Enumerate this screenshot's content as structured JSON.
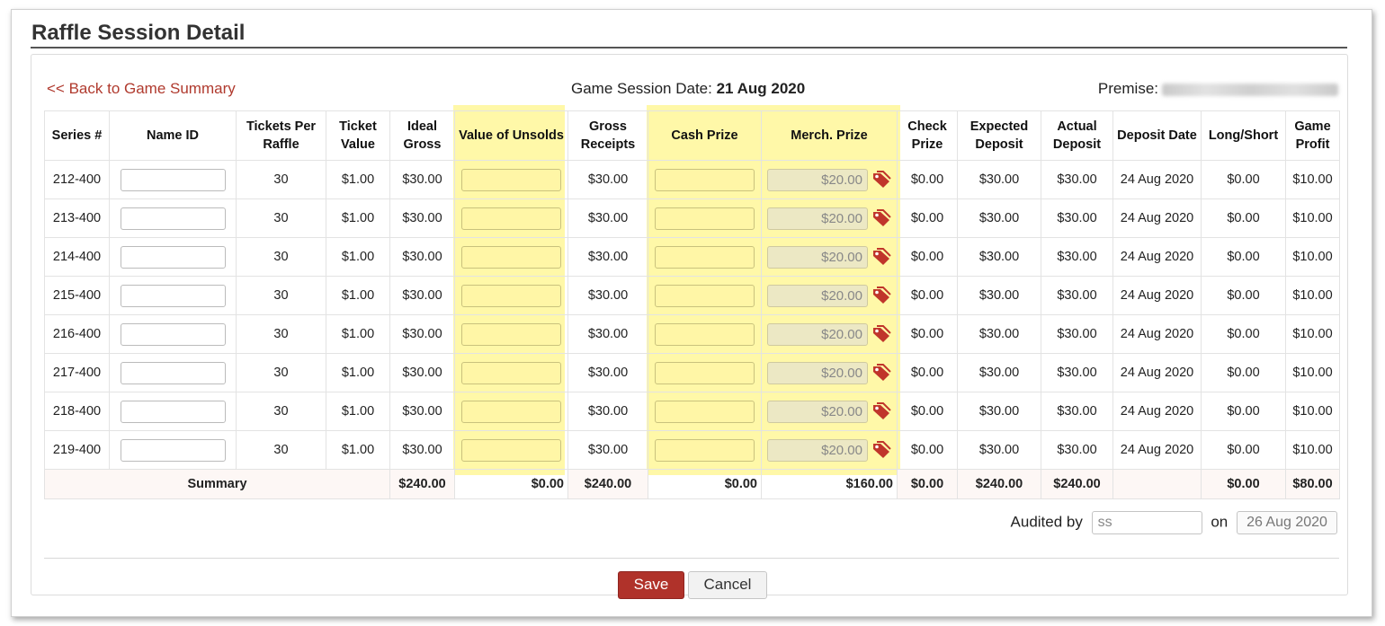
{
  "page_title": "Raffle Session Detail",
  "back_link": "<< Back to Game Summary",
  "session_date_label": "Game Session Date:",
  "session_date_value": "21 Aug 2020",
  "premise_label": "Premise:",
  "headers": [
    "Series #",
    "Name ID",
    "Tickets Per Raffle",
    "Ticket Value",
    "Ideal Gross",
    "Value of Unsolds",
    "Gross Receipts",
    "Cash Prize",
    "Merch. Prize",
    "Check Prize",
    "Expected Deposit",
    "Actual Deposit",
    "Deposit Date",
    "Long/Short",
    "Game Profit"
  ],
  "rows": [
    {
      "series": "212-400",
      "tickets": "30",
      "ticket_value": "$1.00",
      "ideal_gross": "$30.00",
      "gross_receipts": "$30.00",
      "merch_prize": "$20.00",
      "check_prize": "$0.00",
      "expected_deposit": "$30.00",
      "actual_deposit": "$30.00",
      "deposit_date": "24 Aug 2020",
      "long_short": "$0.00",
      "game_profit": "$10.00"
    },
    {
      "series": "213-400",
      "tickets": "30",
      "ticket_value": "$1.00",
      "ideal_gross": "$30.00",
      "gross_receipts": "$30.00",
      "merch_prize": "$20.00",
      "check_prize": "$0.00",
      "expected_deposit": "$30.00",
      "actual_deposit": "$30.00",
      "deposit_date": "24 Aug 2020",
      "long_short": "$0.00",
      "game_profit": "$10.00"
    },
    {
      "series": "214-400",
      "tickets": "30",
      "ticket_value": "$1.00",
      "ideal_gross": "$30.00",
      "gross_receipts": "$30.00",
      "merch_prize": "$20.00",
      "check_prize": "$0.00",
      "expected_deposit": "$30.00",
      "actual_deposit": "$30.00",
      "deposit_date": "24 Aug 2020",
      "long_short": "$0.00",
      "game_profit": "$10.00"
    },
    {
      "series": "215-400",
      "tickets": "30",
      "ticket_value": "$1.00",
      "ideal_gross": "$30.00",
      "gross_receipts": "$30.00",
      "merch_prize": "$20.00",
      "check_prize": "$0.00",
      "expected_deposit": "$30.00",
      "actual_deposit": "$30.00",
      "deposit_date": "24 Aug 2020",
      "long_short": "$0.00",
      "game_profit": "$10.00"
    },
    {
      "series": "216-400",
      "tickets": "30",
      "ticket_value": "$1.00",
      "ideal_gross": "$30.00",
      "gross_receipts": "$30.00",
      "merch_prize": "$20.00",
      "check_prize": "$0.00",
      "expected_deposit": "$30.00",
      "actual_deposit": "$30.00",
      "deposit_date": "24 Aug 2020",
      "long_short": "$0.00",
      "game_profit": "$10.00"
    },
    {
      "series": "217-400",
      "tickets": "30",
      "ticket_value": "$1.00",
      "ideal_gross": "$30.00",
      "gross_receipts": "$30.00",
      "merch_prize": "$20.00",
      "check_prize": "$0.00",
      "expected_deposit": "$30.00",
      "actual_deposit": "$30.00",
      "deposit_date": "24 Aug 2020",
      "long_short": "$0.00",
      "game_profit": "$10.00"
    },
    {
      "series": "218-400",
      "tickets": "30",
      "ticket_value": "$1.00",
      "ideal_gross": "$30.00",
      "gross_receipts": "$30.00",
      "merch_prize": "$20.00",
      "check_prize": "$0.00",
      "expected_deposit": "$30.00",
      "actual_deposit": "$30.00",
      "deposit_date": "24 Aug 2020",
      "long_short": "$0.00",
      "game_profit": "$10.00"
    },
    {
      "series": "219-400",
      "tickets": "30",
      "ticket_value": "$1.00",
      "ideal_gross": "$30.00",
      "gross_receipts": "$30.00",
      "merch_prize": "$20.00",
      "check_prize": "$0.00",
      "expected_deposit": "$30.00",
      "actual_deposit": "$30.00",
      "deposit_date": "24 Aug 2020",
      "long_short": "$0.00",
      "game_profit": "$10.00"
    }
  ],
  "summary": {
    "label": "Summary",
    "ideal_gross": "$240.00",
    "value_unsolds": "$0.00",
    "gross_receipts": "$240.00",
    "cash_prize": "$0.00",
    "merch_prize": "$160.00",
    "check_prize": "$0.00",
    "expected_deposit": "$240.00",
    "actual_deposit": "$240.00",
    "long_short": "$0.00",
    "game_profit": "$80.00"
  },
  "audit": {
    "label": "Audited by",
    "value": "ss",
    "on_label": "on",
    "date": "26 Aug 2020"
  },
  "buttons": {
    "save": "Save",
    "cancel": "Cancel"
  },
  "colors": {
    "highlight": "#fff8a8",
    "accent": "#b0322a",
    "link": "#b03a2e"
  },
  "icons": {
    "merch_tag": "price-tag-icon"
  }
}
